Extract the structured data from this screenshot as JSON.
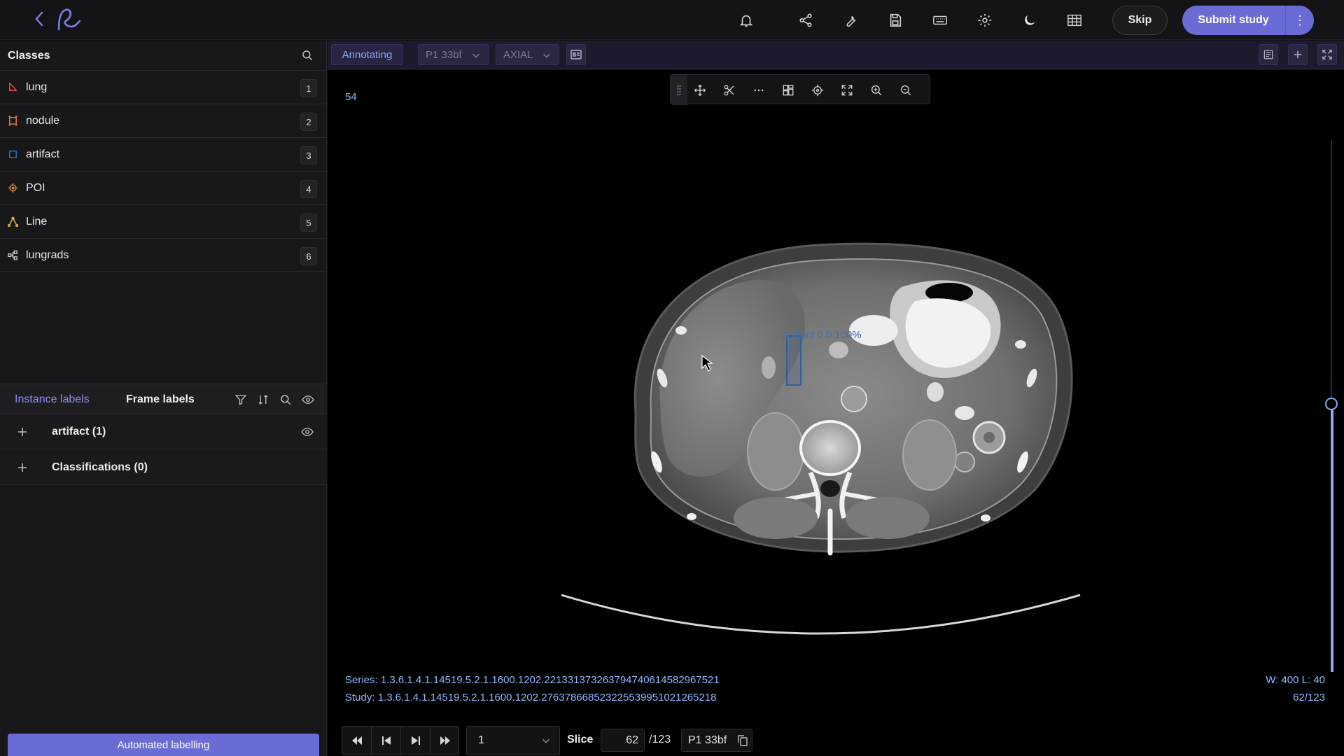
{
  "topbar": {
    "skip_label": "Skip",
    "submit_label": "Submit study",
    "more_glyph": "⋮",
    "icons": [
      "back-icon",
      "logo-icon",
      "bell-icon",
      "share-icon",
      "wrench-icon",
      "save-icon",
      "keyboard-icon",
      "gear-icon",
      "moon-icon",
      "grid-icon"
    ]
  },
  "classes": {
    "title": "Classes",
    "items": [
      {
        "label": "lung",
        "key": "1",
        "icon": "polygon-icon",
        "color": "#d84a4a"
      },
      {
        "label": "nodule",
        "key": "2",
        "icon": "box-icon",
        "color": "#e07a3a"
      },
      {
        "label": "artifact",
        "key": "3",
        "icon": "box-icon",
        "color": "#2f6db5"
      },
      {
        "label": "POI",
        "key": "4",
        "icon": "point-icon",
        "color": "#e88a2c"
      },
      {
        "label": "Line",
        "key": "5",
        "icon": "polyline-icon",
        "color": "#e0b43a"
      },
      {
        "label": "lungrads",
        "key": "6",
        "icon": "classification-icon",
        "color": "#c8c8cc"
      }
    ]
  },
  "labels": {
    "tabs": [
      "Instance labels",
      "Frame labels"
    ],
    "groups": [
      {
        "label": "artifact (1)"
      },
      {
        "label": "Classifications (0)"
      }
    ]
  },
  "automated_labelling": "Automated labelling",
  "viewer": {
    "mode": "Annotating",
    "series_select": "P1 33bf",
    "plane_select": "AXIAL",
    "frame_number": "54",
    "annotation_label": "artifact 0.0 100%",
    "annotation_color": "#2f5f9e",
    "series_uid": "Series: 1.3.6.1.4.1.14519.5.2.1.1600.1202.221331373263794740614582967521",
    "study_uid": "Study: 1.3.6.1.4.1.14519.5.2.1.1600.1202.276378668523225539951021265218",
    "window_level": "W: 400 L: 40",
    "frame_position": "62/123",
    "slice_fraction": 0.504
  },
  "controls": {
    "speed": "1",
    "slice_label": "Slice",
    "slice_value": "62",
    "slice_total": "/123",
    "series_chip": "P1 33bf"
  },
  "accent_color": "#6b6bd6"
}
